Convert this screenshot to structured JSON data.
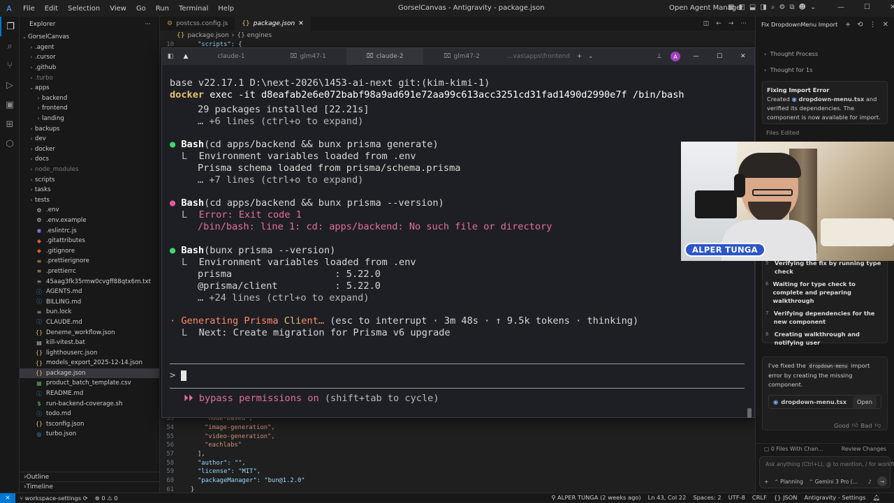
{
  "titlebar": {
    "menus": [
      "File",
      "Edit",
      "Selection",
      "View",
      "Go",
      "Run",
      "Terminal",
      "Help"
    ],
    "window_title": "GorselCanvas - Antigravity - package.json",
    "open_agent_manager": "Open Agent Manager"
  },
  "explorer": {
    "header": "Explorer",
    "project": "GorselCanvas",
    "items": [
      {
        "label": ".agent",
        "type": "folder",
        "depth": 1
      },
      {
        "label": ".cursor",
        "type": "folder",
        "depth": 1
      },
      {
        "label": ".github",
        "type": "folder",
        "depth": 1
      },
      {
        "label": ".turbo",
        "type": "folder",
        "depth": 1,
        "dim": true
      },
      {
        "label": "apps",
        "type": "folder-open",
        "depth": 1
      },
      {
        "label": "backend",
        "type": "folder",
        "depth": 2
      },
      {
        "label": "frontend",
        "type": "folder",
        "depth": 2
      },
      {
        "label": "landing",
        "type": "folder",
        "depth": 2
      },
      {
        "label": "backups",
        "type": "folder",
        "depth": 1
      },
      {
        "label": "dev",
        "type": "folder",
        "depth": 1
      },
      {
        "label": "docker",
        "type": "folder",
        "depth": 1
      },
      {
        "label": "docs",
        "type": "folder",
        "depth": 1
      },
      {
        "label": "node_modules",
        "type": "folder",
        "depth": 1,
        "dim": true
      },
      {
        "label": "scripts",
        "type": "folder",
        "depth": 1
      },
      {
        "label": "tasks",
        "type": "folder",
        "depth": 1
      },
      {
        "label": "tests",
        "type": "folder",
        "depth": 1
      },
      {
        "label": ".env",
        "type": "file",
        "icon": "gear",
        "depth": 1
      },
      {
        "label": ".env.example",
        "type": "file",
        "icon": "gear",
        "depth": 1
      },
      {
        "label": ".eslintrc.js",
        "type": "file",
        "icon": "eslint",
        "depth": 1
      },
      {
        "label": ".gitattributes",
        "type": "file",
        "icon": "git",
        "depth": 1
      },
      {
        "label": ".gitignore",
        "type": "file",
        "icon": "git",
        "depth": 1
      },
      {
        "label": ".prettierignore",
        "type": "file",
        "icon": "prettier",
        "depth": 1
      },
      {
        "label": ".prettierrc",
        "type": "file",
        "icon": "prettier",
        "depth": 1
      },
      {
        "label": "45aag3fk35rmw0cvgff88qtx6m.txt",
        "type": "file",
        "icon": "text",
        "depth": 1
      },
      {
        "label": "AGENTS.md",
        "type": "file",
        "icon": "info",
        "depth": 1
      },
      {
        "label": "BILLING.md",
        "type": "file",
        "icon": "info",
        "depth": 1
      },
      {
        "label": "bun.lock",
        "type": "file",
        "icon": "text",
        "depth": 1
      },
      {
        "label": "CLAUDE.md",
        "type": "file",
        "icon": "info",
        "depth": 1
      },
      {
        "label": "Deneme_workflow.json",
        "type": "file",
        "icon": "json",
        "depth": 1
      },
      {
        "label": "kill-vitest.bat",
        "type": "file",
        "icon": "bat",
        "depth": 1
      },
      {
        "label": "lighthouserc.json",
        "type": "file",
        "icon": "json",
        "depth": 1
      },
      {
        "label": "models_export_2025-12-14.json",
        "type": "file",
        "icon": "json",
        "depth": 1
      },
      {
        "label": "package.json",
        "type": "file",
        "icon": "json",
        "depth": 1,
        "selected": true
      },
      {
        "label": "product_batch_template.csv",
        "type": "file",
        "icon": "csv",
        "depth": 1
      },
      {
        "label": "README.md",
        "type": "file",
        "icon": "info",
        "depth": 1
      },
      {
        "label": "run-backend-coverage.sh",
        "type": "file",
        "icon": "sh",
        "depth": 1
      },
      {
        "label": "todo.md",
        "type": "file",
        "icon": "info",
        "depth": 1
      },
      {
        "label": "tsconfig.json",
        "type": "file",
        "icon": "json",
        "depth": 1
      },
      {
        "label": "turbo.json",
        "type": "file",
        "icon": "turbo",
        "depth": 1
      }
    ],
    "outline": "Outline",
    "timeline": "Timeline"
  },
  "editor": {
    "tabs": [
      {
        "label": "postcss.config.js",
        "active": false
      },
      {
        "label": "package.json",
        "active": true
      }
    ],
    "breadcrumb": [
      "package.json",
      "{} engines"
    ],
    "top_line": {
      "num": "10",
      "text": "\"scripts\": {"
    },
    "lines": [
      {
        "num": "53",
        "text": "\"node-based\","
      },
      {
        "num": "54",
        "text": "\"image-generation\","
      },
      {
        "num": "55",
        "text": "\"video-generation\","
      },
      {
        "num": "56",
        "text": "\"eachlabs\""
      },
      {
        "num": "57",
        "text": "],"
      },
      {
        "num": "58",
        "text": "\"author\": \"\","
      },
      {
        "num": "59",
        "text": "\"license\": \"MIT\","
      },
      {
        "num": "60",
        "text": "\"packageManager\": \"bun@1.2.0\""
      },
      {
        "num": "61",
        "text": "}"
      }
    ]
  },
  "terminal": {
    "tabs": [
      "claude-1",
      "glm47-1",
      "claude-2",
      "glm47-2",
      "...vas\\apps\\frontend"
    ],
    "avatar_letter": "A",
    "prompt_line": "base v22.17.1 D:\\next-2026\\1453-ai-next git:(kim-kimi-1)",
    "docker_cmd": "docker",
    "docker_args": " exec -it d8eafab2e6e072babf98a9ad691e72aa99c613acc3251cd31fad1490d2990e7f /bin/bash",
    "l_installed": "29 packages installed [22.21s]",
    "l_expand1": "… +6 lines (ctrl+o to expand)",
    "b1_cmd": "(cd apps/backend && bunx prisma generate)",
    "b1_out1": "Environment variables loaded from .env",
    "b1_out2": "Prisma schema loaded from prisma/schema.prisma",
    "b1_expand": "… +7 lines (ctrl+o to expand)",
    "b2_cmd": "(cd apps/backend && bunx prisma --version)",
    "b2_err1": "Error: Exit code 1",
    "b2_err2": "/bin/bash: line 1: cd: apps/backend: No such file or directory",
    "b3_cmd": "(bunx prisma --version)",
    "b3_out1": "Environment variables loaded from .env",
    "b3_out2": "prisma                  : 5.22.0",
    "b3_out3": "@prisma/client          : 5.22.0",
    "b3_expand": "… +24 lines (ctrl+o to expand)",
    "bash": "Bash",
    "status_a": "Generating Prisma ",
    "status_b": "Cli",
    "status_c": "ent…",
    "status_rest": " (esc to interrupt · 3m 48s · ↑ 9.5k tokens · thinking)",
    "next": "Next: Create migration for Prisma v6 upgrade",
    "input_prompt": ">",
    "bypass": "bypass permissions on",
    "bypass_rest": " (shift+tab to cycle)"
  },
  "agent_panel": {
    "title": "Fix DropdownMenu Import",
    "thought_process": "Thought Process",
    "thought_for": "Thought for 1s",
    "fix_title": "Fixing Import Error",
    "fix_text_a": "Created",
    "fix_file": "dropdown-menu.tsx",
    "fix_text_b": "and verified its dependencies. The component is now available for import.",
    "files_edited": "Files Edited",
    "steps": [
      {
        "num": "5",
        "text": "Verifying the fix by running type check"
      },
      {
        "num": "6",
        "text": "Waiting for type check to complete and preparing walkthrough"
      },
      {
        "num": "7",
        "text": "Verifying dependencies for the new component"
      },
      {
        "num": "8",
        "text": "Creating walkthrough and notifying user"
      }
    ],
    "summary_a": "I've fixed the",
    "summary_code": "dropdown-menu",
    "summary_b": "import error by creating the missing component.",
    "file_chip": "dropdown-menu.tsx",
    "open_btn": "Open",
    "good": "Good",
    "bad": "Bad",
    "files_changed": "0 Files With Chan...",
    "review_changes": "Review Changes",
    "ask_placeholder": "Ask anything (Ctrl+L), @ to mention, / for workfl",
    "mode": "Planning",
    "model": "Gemini 3 Pro (..."
  },
  "webcam": {
    "name_tag": "ALPER TUNGA"
  },
  "statusbar": {
    "branch": "workspace-settings",
    "errors": "0",
    "warnings": "0",
    "blame": "ALPER TUNGA (2 weeks ago)",
    "position": "Ln 43, Col 22",
    "spaces": "Spaces: 2",
    "encoding": "UTF-8",
    "eol": "CRLF",
    "language": "JSON",
    "settings": "Antigravity - Settings"
  },
  "colors": {
    "accent": "#0078d4",
    "term_green": "#3fd86c",
    "term_pink": "#e8589c",
    "term_orange": "#ff8a63",
    "name_tag_bg": "#2b55c8"
  }
}
